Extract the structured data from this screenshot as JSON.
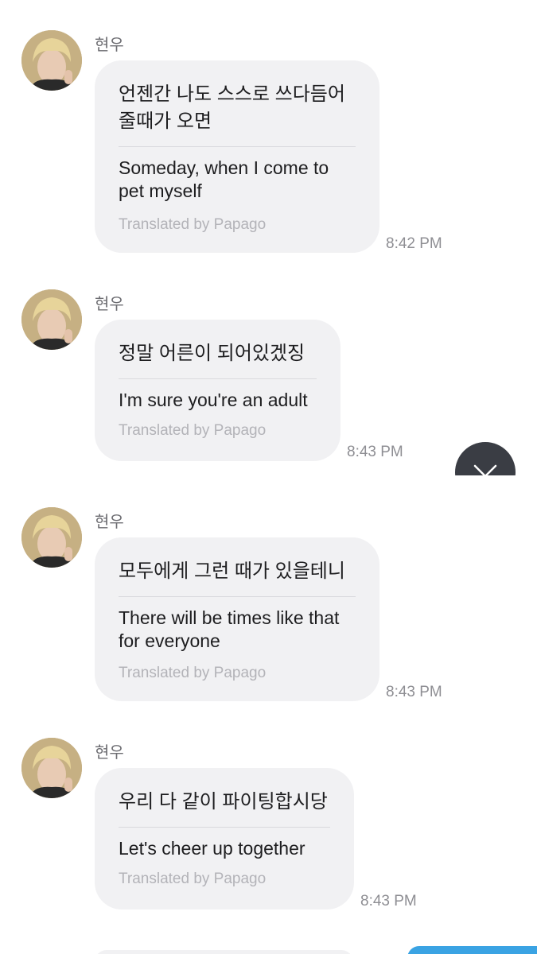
{
  "messages": [
    {
      "sender": "현우",
      "original": "언젠간 나도 스스로 쓰다듬어\n줄때가 오면",
      "translation": "Someday, when I come to\npet myself",
      "translated_by": "Translated by Papago",
      "time": "8:42 PM"
    },
    {
      "sender": "현우",
      "original": "정말 어른이 되어있겠징",
      "translation": "I'm sure you're an adult",
      "translated_by": "Translated by Papago",
      "time": "8:43 PM"
    },
    {
      "sender": "현우",
      "original": "모두에게 그런 때가 있을테니",
      "translation": "There will be times like that\nfor everyone",
      "translated_by": "Translated by Papago",
      "time": "8:43 PM"
    },
    {
      "sender": "현우",
      "original": "우리 다 같이 파이팅합시당",
      "translation": "Let's cheer up together",
      "translated_by": "Translated by Papago",
      "time": "8:43 PM"
    }
  ],
  "icons": {
    "fab": "close-icon",
    "avatar": "avatar"
  },
  "colors": {
    "bubble": "#f1f1f3",
    "fab": "#3a3d44",
    "sent_bubble": "#3aa3e3"
  }
}
